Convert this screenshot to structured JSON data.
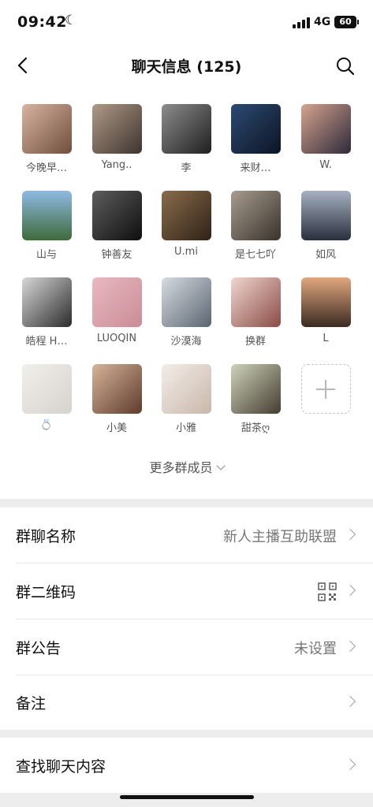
{
  "status_bar": {
    "time": "09:42",
    "moon_icon": "moon-icon",
    "network": "4G",
    "battery": "60"
  },
  "header": {
    "title": "聊天信息 (125)",
    "back_icon": "chevron-left-icon",
    "search_icon": "search-icon"
  },
  "members": [
    {
      "name": "今晚早…",
      "color_a": "#d9b3a1",
      "color_b": "#6f4f3d"
    },
    {
      "name": "Yang..",
      "color_a": "#b09a86",
      "color_b": "#3d3430"
    },
    {
      "name": "李",
      "color_a": "#8d8d8d",
      "color_b": "#1f1f1f"
    },
    {
      "name": "来财…",
      "color_a": "#2c4a73",
      "color_b": "#0d1424"
    },
    {
      "name": "W.",
      "color_a": "#d7a38f",
      "color_b": "#2d2a3a"
    },
    {
      "name": "山与",
      "color_a": "#8fb9e3",
      "color_b": "#3e6b3a"
    },
    {
      "name": "钟善友",
      "color_a": "#5d5d5d",
      "color_b": "#0f0f0f"
    },
    {
      "name": "U.mi",
      "color_a": "#8a6c4a",
      "color_b": "#2e2218"
    },
    {
      "name": "是七七吖",
      "color_a": "#a69b8e",
      "color_b": "#3a332c"
    },
    {
      "name": "如风",
      "color_a": "#a7b1c2",
      "color_b": "#2a2f3d"
    },
    {
      "name": "皓程 H…",
      "color_a": "#d8d8d8",
      "color_b": "#2b2b2b"
    },
    {
      "name": "LUOQIN",
      "color_a": "#eab8c0",
      "color_b": "#c98d97"
    },
    {
      "name": "沙漠海",
      "color_a": "#d7dce2",
      "color_b": "#5a6470"
    },
    {
      "name": "换群",
      "color_a": "#f0d6cf",
      "color_b": "#8a4b45"
    },
    {
      "name": "L",
      "color_a": "#e0a77e",
      "color_b": "#3b2a22"
    },
    {
      "name": "💍",
      "color_a": "#f1efec",
      "color_b": "#d6d2cc"
    },
    {
      "name": "小美",
      "color_a": "#d8b39a",
      "color_b": "#5d3c2d"
    },
    {
      "name": "小雅",
      "color_a": "#f3ede8",
      "color_b": "#c9b7aa"
    },
    {
      "name": "甜茶ღ",
      "color_a": "#cfd3b9",
      "color_b": "#433c32"
    }
  ],
  "add_member_icon": "plus-icon",
  "more_members": {
    "label": "更多群成员",
    "icon": "chevron-down-icon"
  },
  "settings": {
    "group_name": {
      "label": "群聊名称",
      "value": "新人主播互助联盟"
    },
    "qr_code": {
      "label": "群二维码",
      "icon": "qr-code-icon"
    },
    "announcement": {
      "label": "群公告",
      "value": "未设置"
    },
    "remark": {
      "label": "备注"
    }
  },
  "search_chat": {
    "label": "查找聊天内容"
  }
}
